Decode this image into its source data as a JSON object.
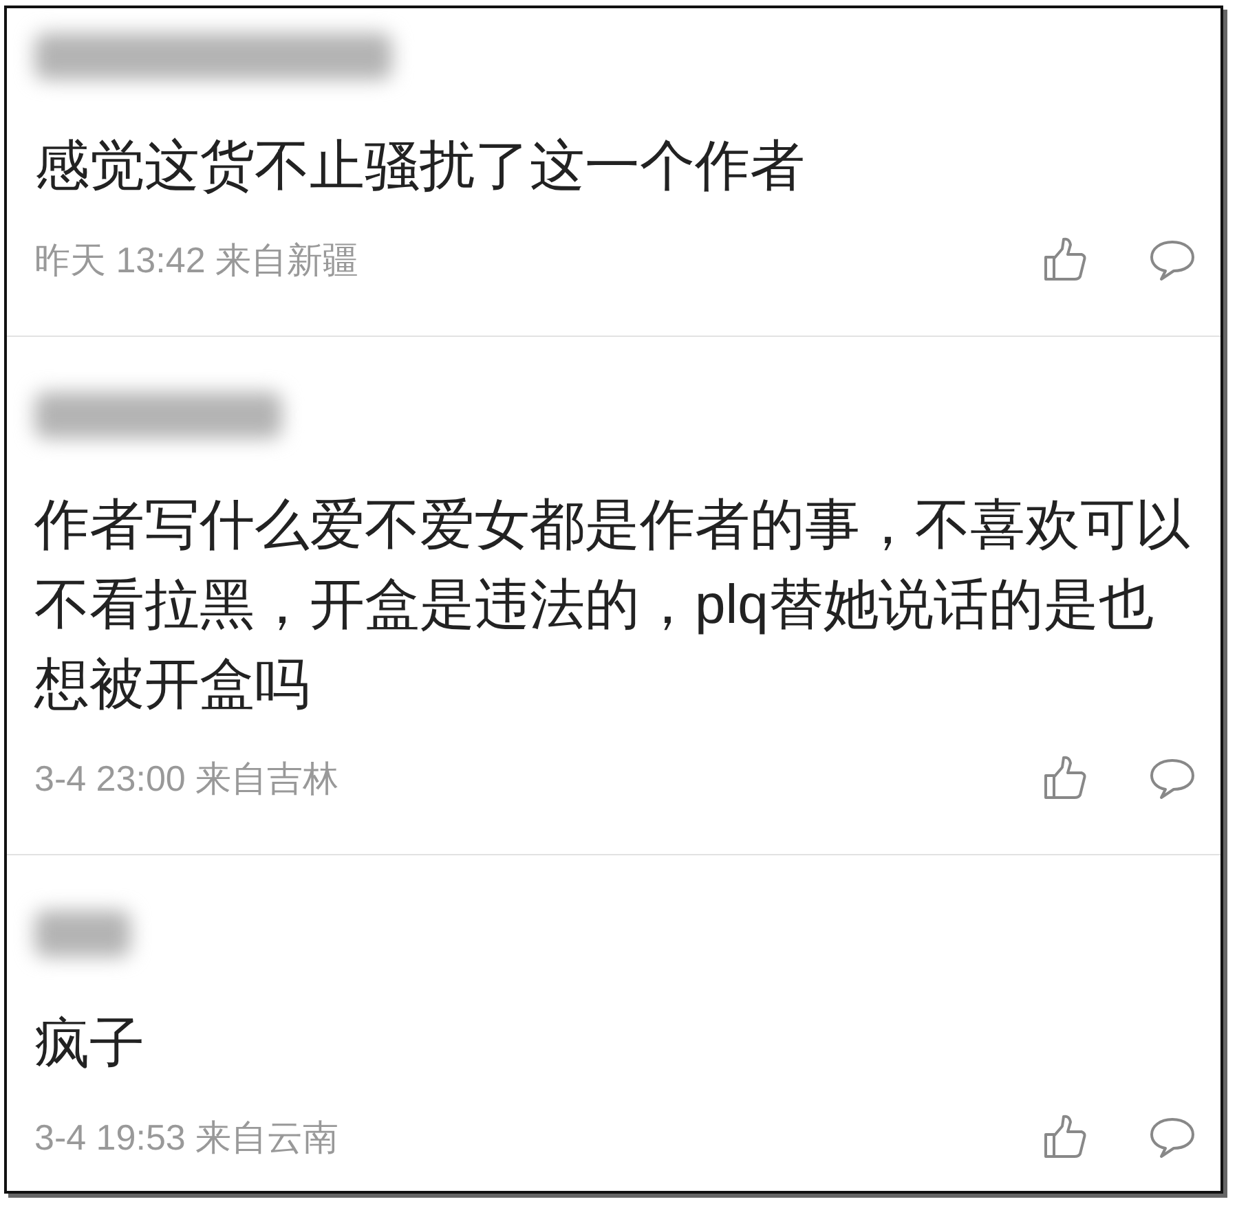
{
  "comments": [
    {
      "text": "感觉这货不止骚扰了这一个作者",
      "meta": "昨天 13:42 来自新疆"
    },
    {
      "text": "作者写什么爱不爱女都是作者的事，不喜欢可以不看拉黑，开盒是违法的，plq替她说话的是也想被开盒吗",
      "meta": "3-4 23:00 来自吉林"
    },
    {
      "text": "疯子",
      "meta": "3-4 19:53 来自云南"
    }
  ]
}
